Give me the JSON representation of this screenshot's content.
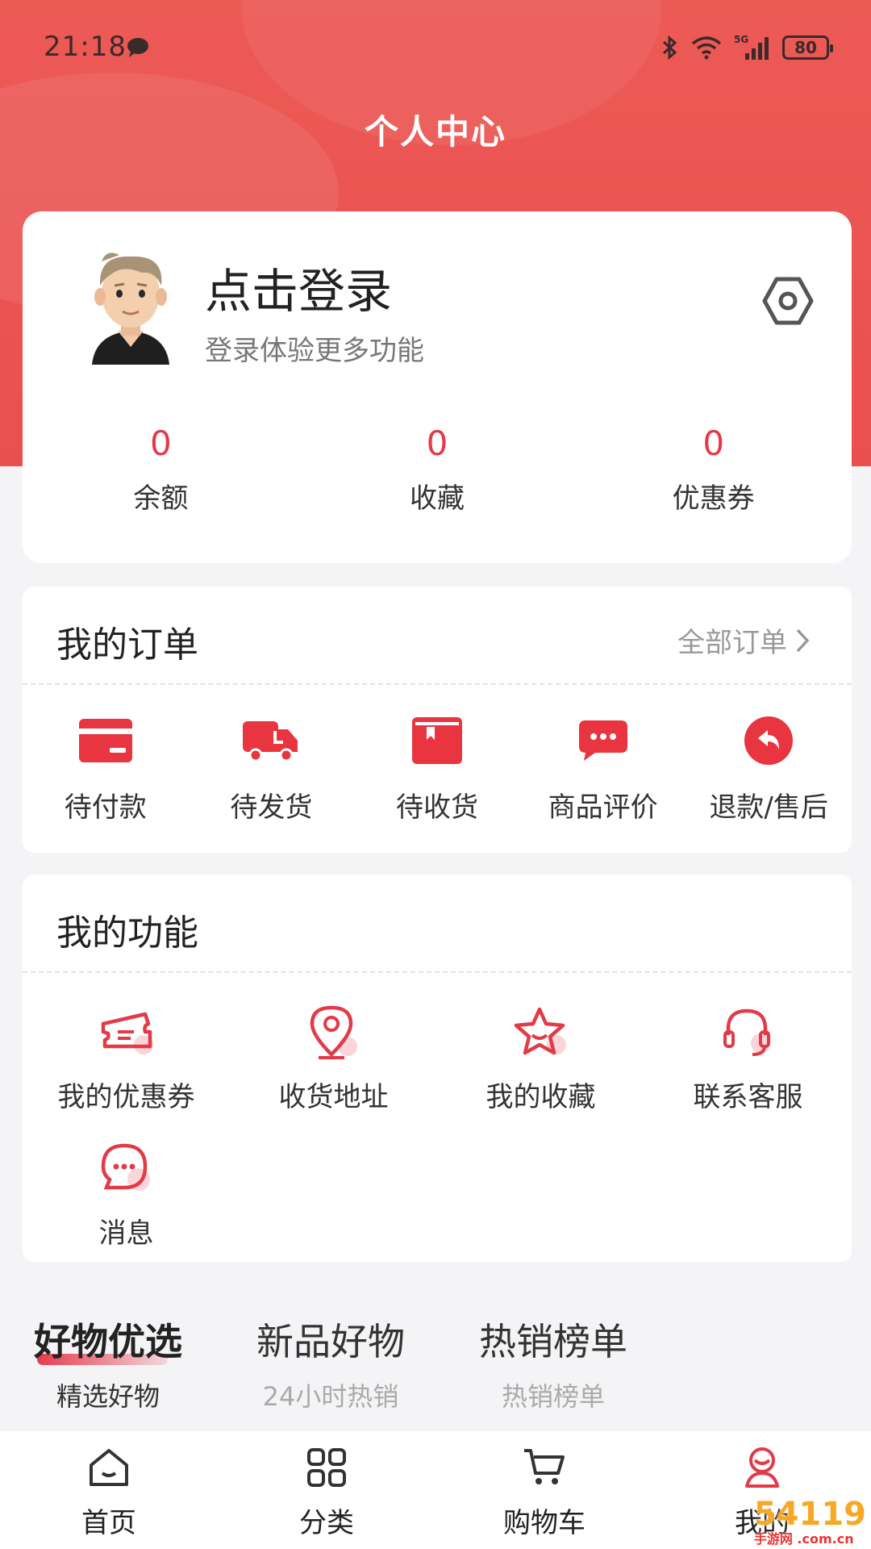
{
  "status_bar": {
    "time": "21:18",
    "network": "5G",
    "battery": "80"
  },
  "page": {
    "title": "个人中心"
  },
  "profile": {
    "login_title": "点击登录",
    "login_subtitle": "登录体验更多功能",
    "stats": [
      {
        "value": "0",
        "label": "余额"
      },
      {
        "value": "0",
        "label": "收藏"
      },
      {
        "value": "0",
        "label": "优惠券"
      }
    ]
  },
  "orders": {
    "title": "我的订单",
    "all_label": "全部订单",
    "items": [
      {
        "label": "待付款",
        "icon": "card-icon"
      },
      {
        "label": "待发货",
        "icon": "truck-icon"
      },
      {
        "label": "待收货",
        "icon": "box-icon"
      },
      {
        "label": "商品评价",
        "icon": "comment-icon"
      },
      {
        "label": "退款/售后",
        "icon": "return-icon"
      }
    ]
  },
  "features": {
    "title": "我的功能",
    "items": [
      {
        "label": "我的优惠券",
        "icon": "ticket-icon"
      },
      {
        "label": "收货地址",
        "icon": "location-icon"
      },
      {
        "label": "我的收藏",
        "icon": "star-icon"
      },
      {
        "label": "联系客服",
        "icon": "headset-icon"
      },
      {
        "label": "消息",
        "icon": "message-icon"
      }
    ]
  },
  "tabs": [
    {
      "title": "好物优选",
      "subtitle": "精选好物"
    },
    {
      "title": "新品好物",
      "subtitle": "24小时热销"
    },
    {
      "title": "热销榜单",
      "subtitle": "热销榜单"
    }
  ],
  "bottom_nav": [
    {
      "label": "首页",
      "icon": "home-icon"
    },
    {
      "label": "分类",
      "icon": "grid-icon"
    },
    {
      "label": "购物车",
      "icon": "cart-icon"
    },
    {
      "label": "我的",
      "icon": "user-icon"
    }
  ],
  "watermark": {
    "text": "54119",
    "small": "手游网 .com.cn"
  },
  "colors": {
    "brand": "#ea4f4f",
    "accent": "#e23a47",
    "background": "#f4f4f6"
  }
}
